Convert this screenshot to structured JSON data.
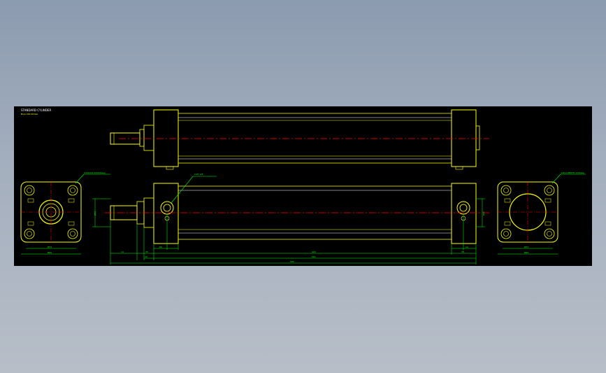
{
  "drawing": {
    "title": "STANDARD CYLINDER",
    "subtitle": "Bore 200 Stroke"
  },
  "callouts": {
    "left_end_note": "4-M10X1.5X20/Deep",
    "right_end_note": "4-Ø11 DEPTH 15/Deep",
    "port_note": "2-PT 1/8"
  },
  "dimensions": {
    "left_width_inner": "Ø72",
    "left_width_outer": "Ø95",
    "right_width_inner": "Ø72",
    "right_width_outer": "Ø95",
    "stroke": "420",
    "overall": "561",
    "total": "585",
    "rod_ext": "14",
    "rod_seg": "30",
    "cap": "60",
    "head_port": "35",
    "tail_port": "38",
    "tail_cap": "14",
    "left_height": "Ø43",
    "right_height": "Ø45"
  },
  "colors": {
    "background": "#000000",
    "outline": "#ffff00",
    "centerline": "#ff0000",
    "dimension": "#00ff00",
    "body_lines": "#ffffff"
  }
}
